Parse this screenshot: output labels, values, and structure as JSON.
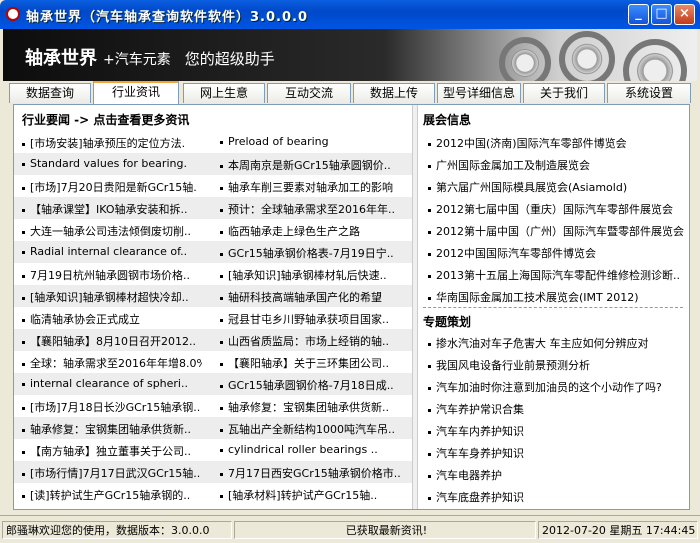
{
  "window": {
    "title": "轴承世界（汽车轴承查询软件软件）3.0.0.0",
    "minimize_glyph": "_",
    "maximize_glyph": "□",
    "close_glyph": "×"
  },
  "banner": {
    "brand": "轴承世界",
    "plus": "+汽车元素",
    "slogan": "您的超级助手"
  },
  "tabs": [
    "数据查询",
    "行业资讯",
    "网上生意",
    "互动交流",
    "数据上传",
    "型号详细信息",
    "关于我们",
    "系统设置"
  ],
  "active_tab": "行业资讯",
  "news": {
    "header": "行业要闻 -> 点击查看更多资讯",
    "rows": [
      [
        "[市场安装]轴承预压的定位方法.",
        "Preload of bearing"
      ],
      [
        "Standard values for bearing.",
        "本周南京是新GCr15轴承圆钢价.."
      ],
      [
        "[市场]7月20日贵阳是新GCr15轴.",
        "轴承车削三要素对轴承加工的影响"
      ],
      [
        "【轴承课堂】IKO轴承安装和拆..",
        "预计：全球轴承需求至2016年年.."
      ],
      [
        "大连一轴承公司违法倾倒废切削..",
        "临西轴承走上绿色生产之路"
      ],
      [
        "Radial internal clearance of..",
        "GCr15轴承钢价格表-7月19日宁.."
      ],
      [
        "7月19日杭州轴承圆钢市场价格..",
        "[轴承知识]轴承钢棒材轧后快速.."
      ],
      [
        "[轴承知识]轴承钢棒材超快冷却..",
        "轴研科技高端轴承国产化的希望"
      ],
      [
        "临清轴承协会正式成立",
        "冠县甘屯乡川野轴承获项目国家.."
      ],
      [
        "【襄阳轴承】8月10日召开2012..",
        "山西省质监局：市场上经销的轴.."
      ],
      [
        "全球：轴承需求至2016年年增8.0%",
        "【襄阳轴承】关于三环集团公司.."
      ],
      [
        "internal clearance of spheri..",
        "GCr15轴承圆钢价格-7月18日成.."
      ],
      [
        "[市场]7月18日长沙GCr15轴承钢..",
        "轴承修复：宝钢集团轴承供货新.."
      ],
      [
        "轴承修复：宝钢集团轴承供货新..",
        "瓦轴出产全新结构1000吨汽车吊.."
      ],
      [
        "【南方轴承】独立董事关于公司..",
        "cylindrical roller bearings .."
      ],
      [
        "[市场行情]7月17日武汉GCr15轴..",
        "7月17日西安GCr15轴承钢价格市.."
      ],
      [
        "[读]转护试生产GCr15轴承钢的..",
        "[轴承材料]转护试产GCr15轴.."
      ]
    ]
  },
  "exhibitions": {
    "header": "展会信息",
    "items": [
      "2012中国(济南)国际汽车零部件博览会",
      "广州国际金属加工及制造展览会",
      "第六届广州国际模具展览会(Asiamold)",
      "2012第七届中国（重庆）国际汽车零部件展览会",
      "2012第十届中国（广州）国际汽车暨零部件展览会",
      "2012中国国际汽车零部件博览会",
      "2013第十五届上海国际汽车零配件维修检测诊断..",
      "华南国际金属加工技术展览会(IMT 2012)"
    ]
  },
  "topics": {
    "header": "专题策划",
    "items": [
      "掺水汽油对车子危害大 车主应如何分辨应对",
      "我国风电设备行业前景预测分析",
      "汽车加油时你注意到加油员的这个小动作了吗?",
      "汽车养护常识合集",
      "汽车车内养护知识",
      "汽车车身养护知识",
      "汽车电器养护",
      "汽车底盘养护知识"
    ]
  },
  "status": {
    "welcome": "郎骚琳欢迎您的使用，数据版本：3.0.0.0",
    "message": "已获取最新资讯!",
    "datetime": "2012-07-20 星期五 17:44:45"
  }
}
